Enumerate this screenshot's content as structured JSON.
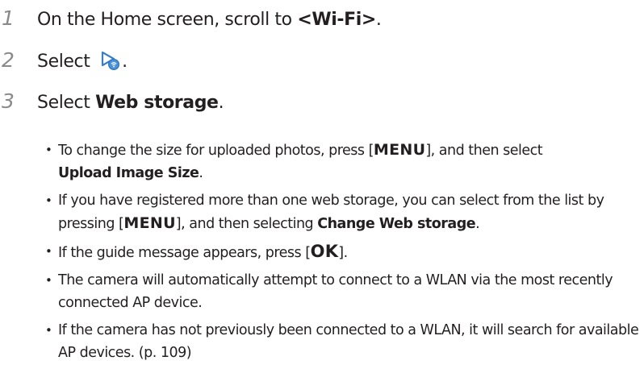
{
  "steps": [
    {
      "number": "1",
      "text_before": "On the Home screen, scroll to ",
      "bold": "<Wi-Fi>",
      "text_after": "."
    },
    {
      "number": "2",
      "text_before": "Select ",
      "icon": "play-share-icon",
      "text_after": "."
    },
    {
      "number": "3",
      "text_before": "Select ",
      "bold": "Web storage",
      "text_after": "."
    }
  ],
  "bullets": [
    {
      "part1": "To change the size for uploaded photos, press [",
      "key": "MENU",
      "part2": "], and then select ",
      "bold": "Upload Image Size",
      "part3": "."
    },
    {
      "part1": "If you have registered more than one web storage, you can select from the list by pressing [",
      "key": "MENU",
      "part2": "], and then selecting ",
      "bold": "Change Web storage",
      "part3": "."
    },
    {
      "part1": "If the guide message appears, press [",
      "key": "OK",
      "part2": "]."
    },
    {
      "text": "The camera will automatically attempt to connect to a WLAN via the most recently connected AP device."
    },
    {
      "text": "If the camera has not previously been connected to a WLAN, it will search for available AP devices. (p. 109)"
    }
  ],
  "colors": {
    "text": "#231f20",
    "step_number": "#8a8a8a",
    "icon_outline": "#3a7fc4",
    "icon_badge": "#2f78c2"
  }
}
